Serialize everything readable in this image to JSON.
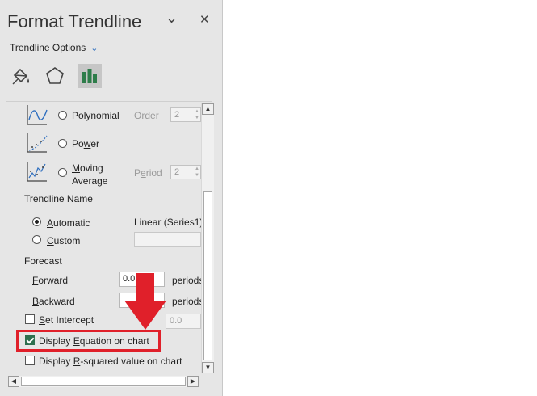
{
  "panel": {
    "title": "Format Trendline",
    "options_label": "Trendline Options",
    "chevron": "chevron-down-icon",
    "close_symbol": "✕",
    "collapse_symbol": "⌄"
  },
  "types": {
    "polynomial": {
      "label_pre": "",
      "label_u": "P",
      "label_post": "olynomial",
      "order_label_pre": "Or",
      "order_label_u": "d",
      "order_label_post": "er",
      "order_value": "2"
    },
    "power": {
      "label_pre": "Po",
      "label_u": "w",
      "label_post": "er"
    },
    "moving": {
      "label_u": "M",
      "label_line1_post": "oving",
      "label_line2": "Average",
      "period_label_pre": "P",
      "period_label_u": "e",
      "period_label_post": "riod",
      "period_value": "2"
    }
  },
  "name": {
    "heading": "Trendline Name",
    "auto_u": "A",
    "auto_post": "utomatic",
    "auto_value": "Linear (Series1)",
    "custom_u": "C",
    "custom_post": "ustom"
  },
  "forecast": {
    "heading": "Forecast",
    "forward_u": "F",
    "forward_post": "orward",
    "forward_value": "0.0",
    "forward_unit": "periods",
    "backward_u": "B",
    "backward_post": "ackward",
    "backward_unit": "periods"
  },
  "intercept": {
    "u": "S",
    "post": "et Intercept",
    "value": "0.0"
  },
  "display_equation": {
    "pre": "Display ",
    "u": "E",
    "post": "quation on chart",
    "checked": true
  },
  "display_r2": {
    "pre": "Display ",
    "u": "R",
    "post": "-squared value on chart",
    "checked": false
  },
  "colors": {
    "accent_red": "#e0202a",
    "check_green": "#2d6f4e",
    "icon_green": "#2e7d4a"
  }
}
